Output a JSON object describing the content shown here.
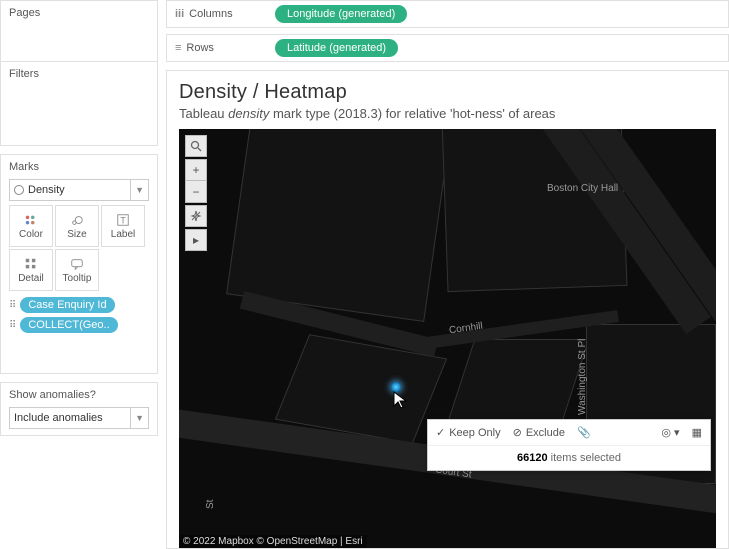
{
  "panels": {
    "pages_title": "Pages",
    "filters_title": "Filters",
    "marks_title": "Marks"
  },
  "marks": {
    "type_label": "Density",
    "btns": {
      "color": "Color",
      "size": "Size",
      "label": "Label",
      "detail": "Detail",
      "tooltip": "Tooltip"
    },
    "pills": {
      "p1": "Case Enquiry Id",
      "p2": "COLLECT(Geo.."
    }
  },
  "anomalies": {
    "title": "Show anomalies?",
    "value": "Include anomalies"
  },
  "shelves": {
    "columns_label": "Columns",
    "columns_pill": "Longitude (generated)",
    "rows_label": "Rows",
    "rows_pill": "Latitude (generated)"
  },
  "viz": {
    "title": "Density / Heatmap",
    "sub_pre": "Tableau ",
    "sub_it": "density",
    "sub_rest": " mark type (2018.3) for relative 'hot-ness' of areas"
  },
  "map": {
    "labels": {
      "cityhall": "Boston City Hall",
      "cornhill": "Cornhill",
      "washington": "Washington St Pl",
      "court": "Court St",
      "st": "St"
    },
    "attribution": "© 2022 Mapbox © OpenStreetMap | Esri"
  },
  "tooltip": {
    "keep": "Keep Only",
    "exclude": "Exclude",
    "count": "66120",
    "items_text": " items selected"
  }
}
